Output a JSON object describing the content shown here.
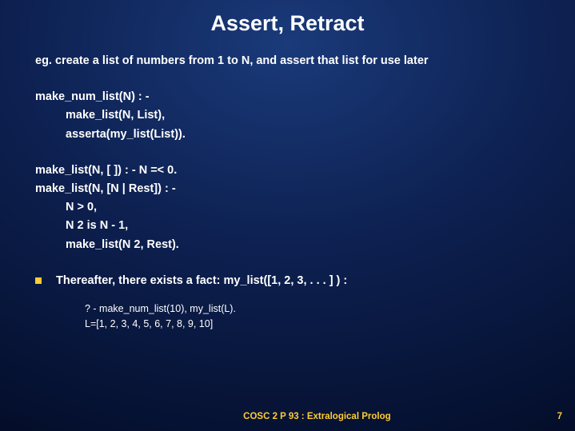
{
  "title": "Assert, Retract",
  "desc": "eg. create a list of numbers from 1 to N, and assert that list for use later",
  "block1": {
    "l0": "make_num_list(N) : -",
    "l1": "make_list(N, List),",
    "l2": "asserta(my_list(List))."
  },
  "block2": {
    "l0": "make_list(N, [ ]) : - N =< 0.",
    "l1": "make_list(N, [N | Rest]) : -",
    "l2": "N > 0,",
    "l3": "N 2 is N - 1,",
    "l4": "make_list(N 2, Rest)."
  },
  "bullet": "Thereafter, there exists a fact:   my_list([1, 2, 3, . . . ] ) :",
  "example": {
    "l0": "? - make_num_list(10), my_list(L).",
    "l1": "L=[1, 2, 3, 4, 5, 6, 7, 8, 9, 10]"
  },
  "footer": {
    "center": "COSC 2 P 93 : Extralogical Prolog",
    "page": "7"
  }
}
